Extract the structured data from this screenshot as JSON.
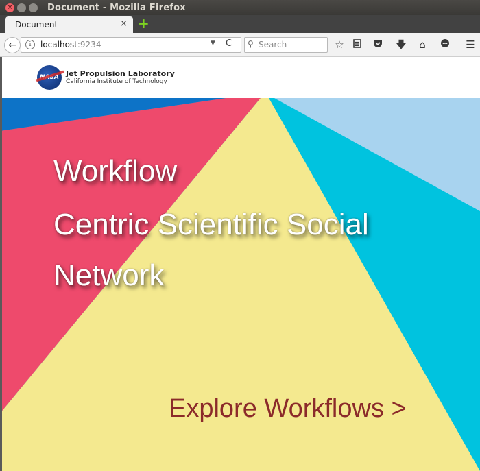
{
  "window": {
    "title": "Document - Mozilla Firefox"
  },
  "tabs": [
    {
      "label": "Document",
      "close": "×"
    }
  ],
  "newtab_symbol": "+",
  "navbar": {
    "back_symbol": "←",
    "info_symbol": "i",
    "url_host": "localhost",
    "url_port": ":9234",
    "dropdown_symbol": "▼",
    "reload_symbol": "C",
    "search_placeholder": "Search",
    "icons": [
      "star-icon",
      "reading-list-icon",
      "pocket-icon",
      "download-icon",
      "home-icon",
      "chat-icon",
      "menu-icon"
    ]
  },
  "header": {
    "logo_text": "NASA",
    "org_name": "Jet Propulsion Laboratory",
    "org_sub": "California Institute of Technology"
  },
  "hero": {
    "headline_lines": [
      "Workflow",
      "Centric Scientific Social",
      "Network"
    ],
    "cta": "Explore Workflows >"
  },
  "colors": {
    "red": "#ee4a6c",
    "yellow": "#f4e98f",
    "cyan": "#00c3df",
    "light_blue": "#a8d3ef",
    "dark_blue": "#0d73c7",
    "cta": "#8b2a2a"
  }
}
